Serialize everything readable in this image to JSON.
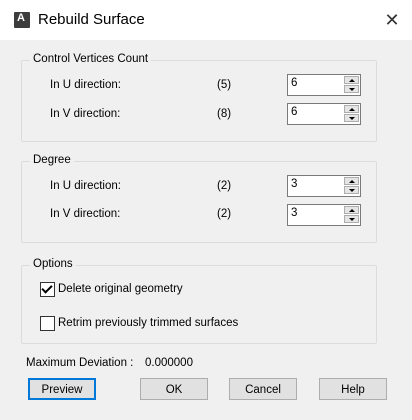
{
  "window": {
    "title": "Rebuild Surface",
    "icon": "autodesk-app-icon",
    "close_glyph": "✕"
  },
  "control_vertices": {
    "group_label": "Control Vertices Count",
    "u": {
      "label": "In U direction:",
      "count": "(5)",
      "value": "6"
    },
    "v": {
      "label": "In V direction:",
      "count": "(8)",
      "value": "6"
    }
  },
  "degree": {
    "group_label": "Degree",
    "u": {
      "label": "In U direction:",
      "count": "(2)",
      "value": "3"
    },
    "v": {
      "label": "In V direction:",
      "count": "(2)",
      "value": "3"
    }
  },
  "options": {
    "group_label": "Options",
    "delete_original": {
      "label": "Delete original geometry",
      "checked": true
    },
    "retrim": {
      "label": "Retrim previously trimmed surfaces",
      "checked": false
    }
  },
  "max_deviation": {
    "label": "Maximum Deviation :",
    "value": "0.000000"
  },
  "buttons": {
    "preview": "Preview",
    "ok": "OK",
    "cancel": "Cancel",
    "help": "Help"
  }
}
